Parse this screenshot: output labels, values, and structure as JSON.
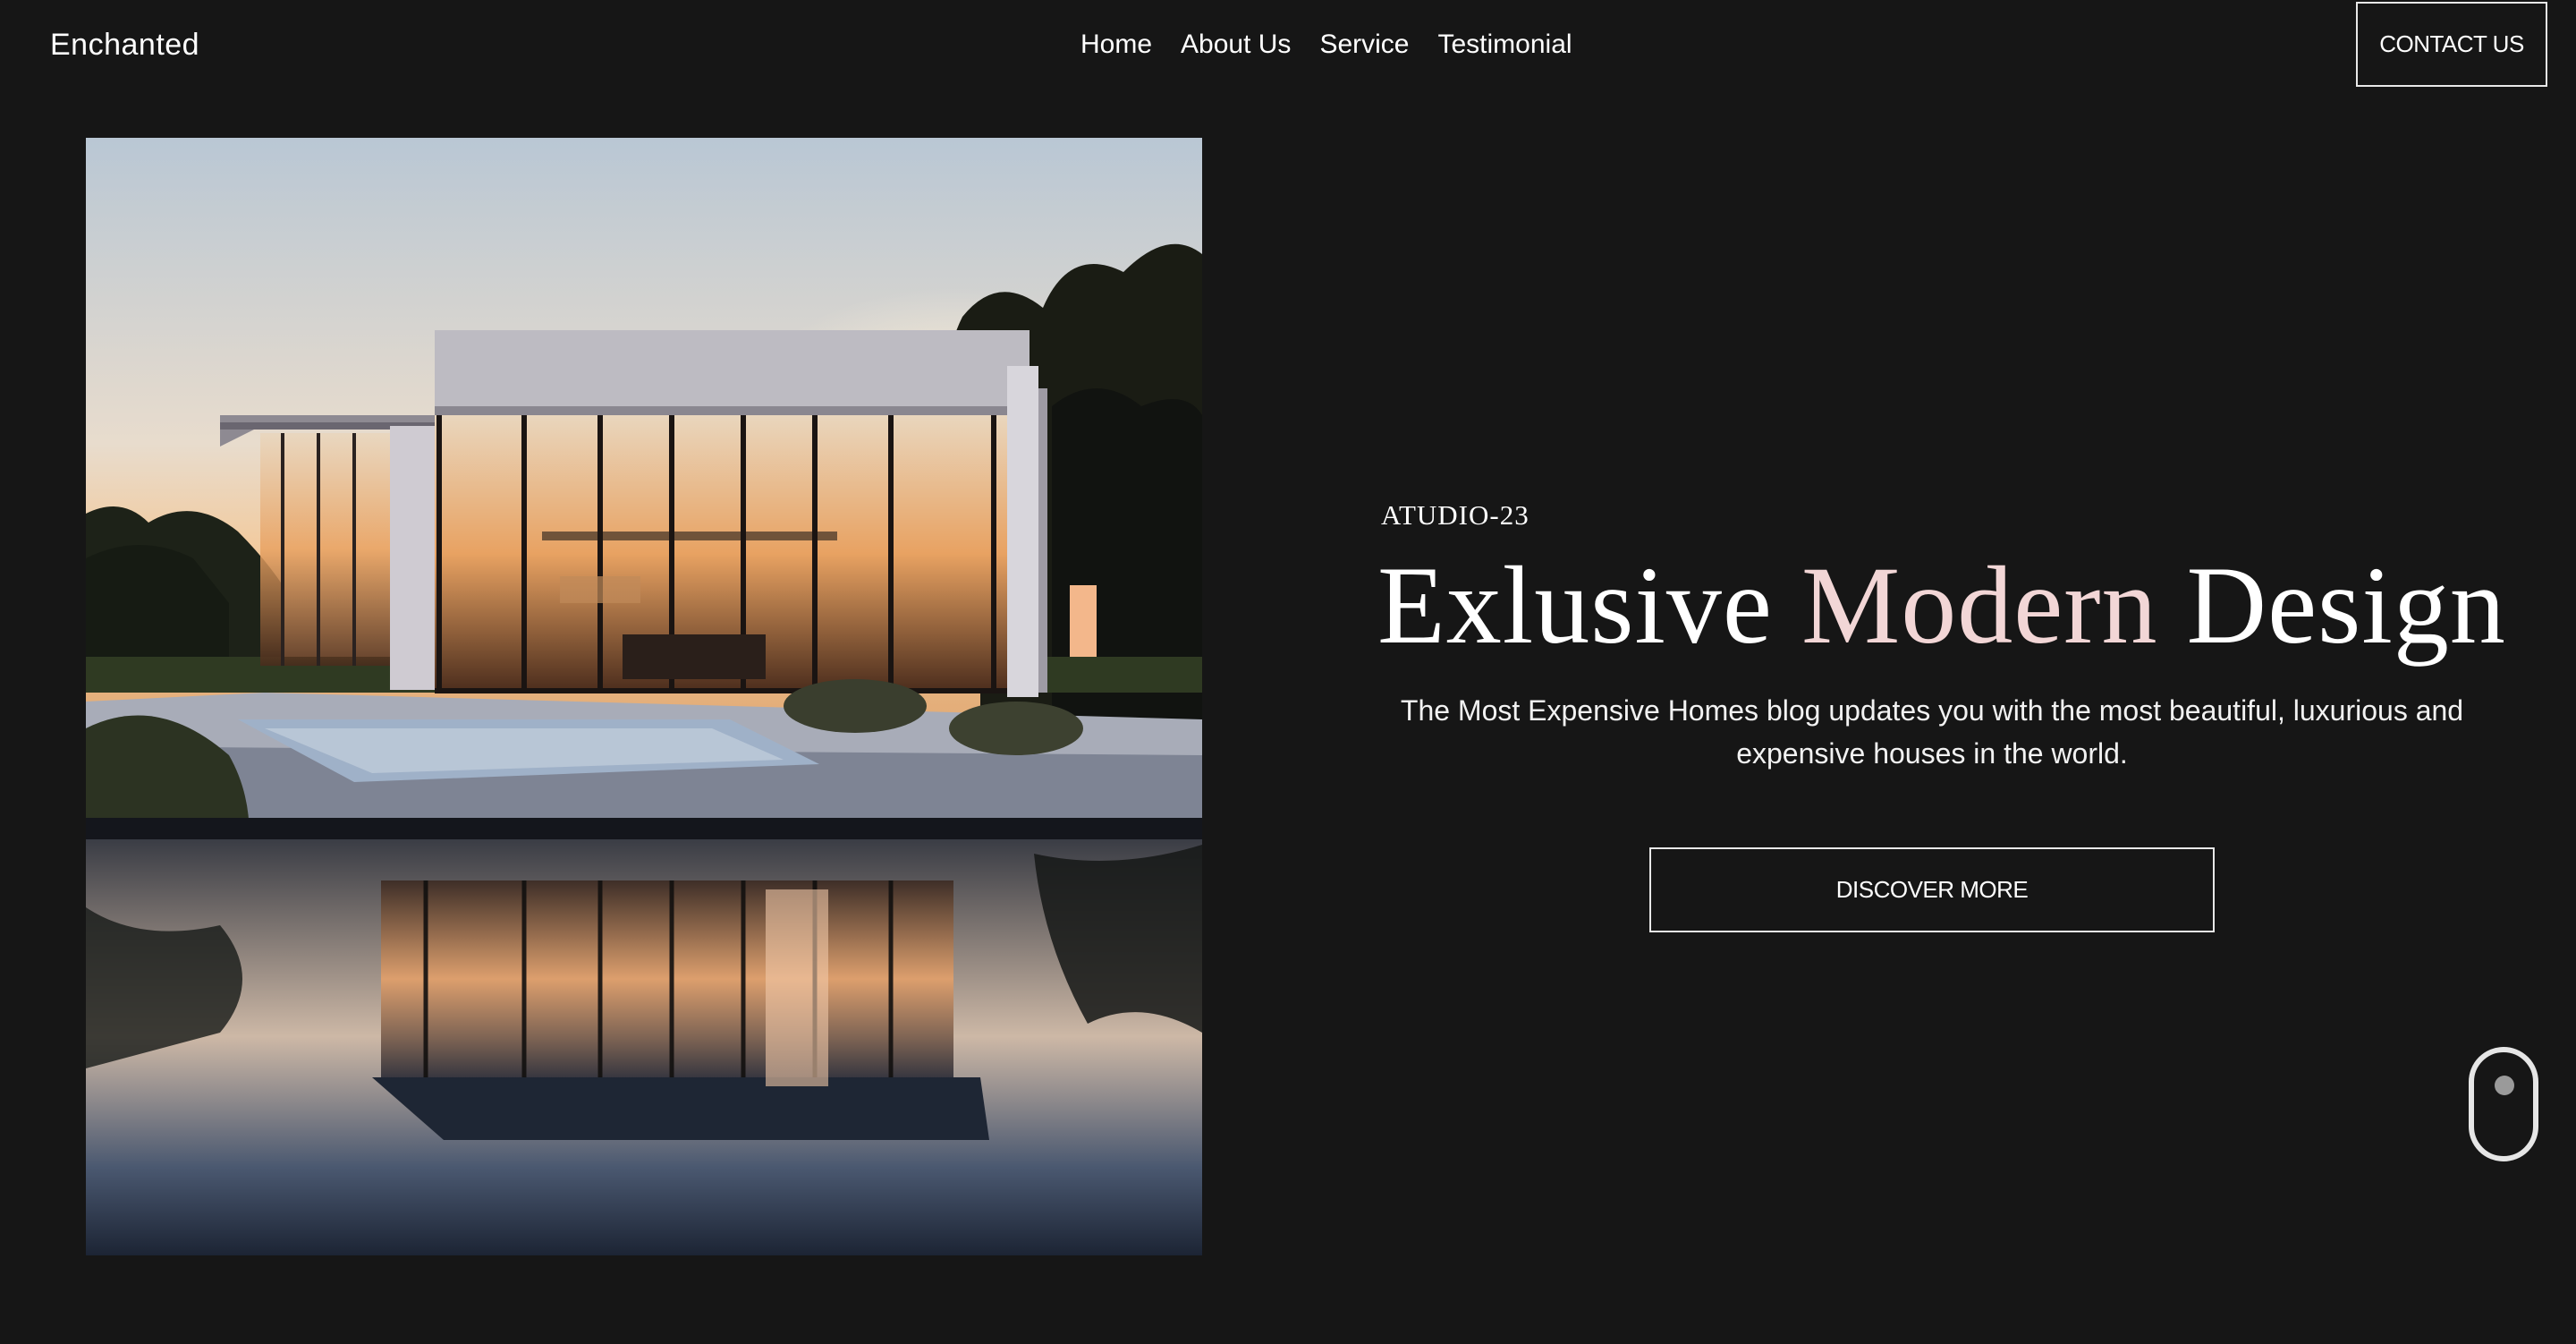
{
  "header": {
    "logo": "Enchanted",
    "nav": [
      "Home",
      "About Us",
      "Service",
      "Testimonial"
    ],
    "contact_label": "CONTACT US"
  },
  "hero": {
    "eyebrow": "ATUDIO-23",
    "headline_part1": "Exlusive",
    "headline_accent": "Modern",
    "headline_part2": "Design",
    "description": "The Most Expensive Homes blog updates you with the most beautiful, luxurious and expensive houses in the world.",
    "cta_label": "DISCOVER MORE",
    "accent_color": "#f2d6d6"
  },
  "icons": {
    "scroll": "mouse-scroll-icon"
  }
}
